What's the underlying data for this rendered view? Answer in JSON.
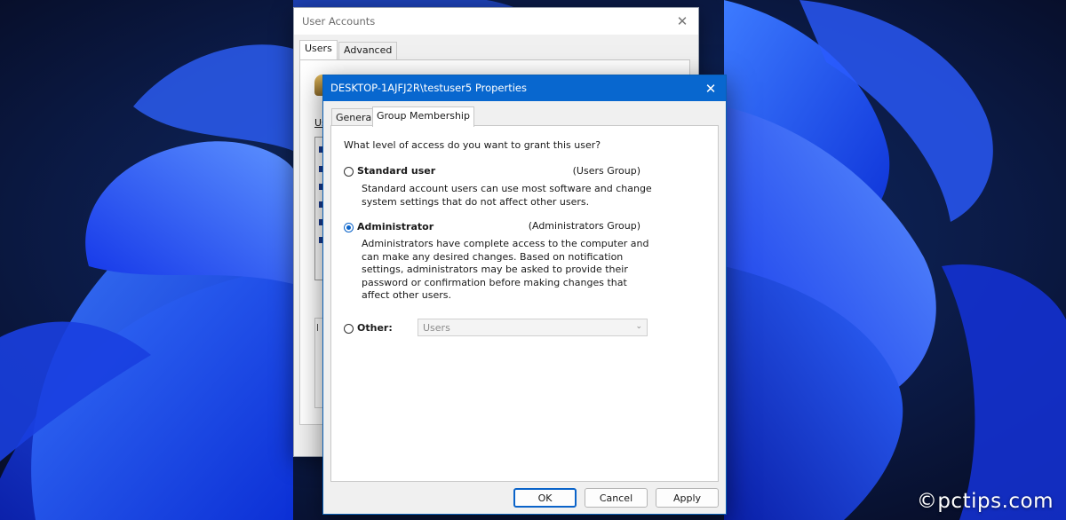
{
  "background_window": {
    "title": "User Accounts",
    "close_glyph": "✕",
    "tabs": [
      {
        "label": "Users",
        "active": true
      },
      {
        "label": "Advanced",
        "active": false
      }
    ],
    "section_label_partial": "Us"
  },
  "dialog": {
    "title": "DESKTOP-1AJFJ2R\\testuser5 Properties",
    "close_glyph": "✕",
    "tabs": [
      {
        "label": "General",
        "active": false
      },
      {
        "label": "Group Membership",
        "active": true
      }
    ],
    "question": "What level of access do you want to grant this user?",
    "options": {
      "standard": {
        "label": "Standard user",
        "group": "(Users Group)",
        "description": "Standard account users can use most software and change system settings that do not affect other users.",
        "selected": false
      },
      "administrator": {
        "label": "Administrator",
        "group": "(Administrators Group)",
        "description": "Administrators have complete access to the computer and can make any desired changes. Based on notification settings, administrators may be asked to provide their password or confirmation before making changes that affect other users.",
        "selected": true
      },
      "other": {
        "label": "Other:",
        "selected": false,
        "select_value": "Users",
        "select_disabled": true
      }
    },
    "buttons": {
      "ok": "OK",
      "cancel": "Cancel",
      "apply": "Apply"
    }
  },
  "watermark": "©pctips.com",
  "colors": {
    "accent": "#0867cf",
    "wallpaper_dark": "#0a1230",
    "wallpaper_blue": "#1d4fff"
  }
}
